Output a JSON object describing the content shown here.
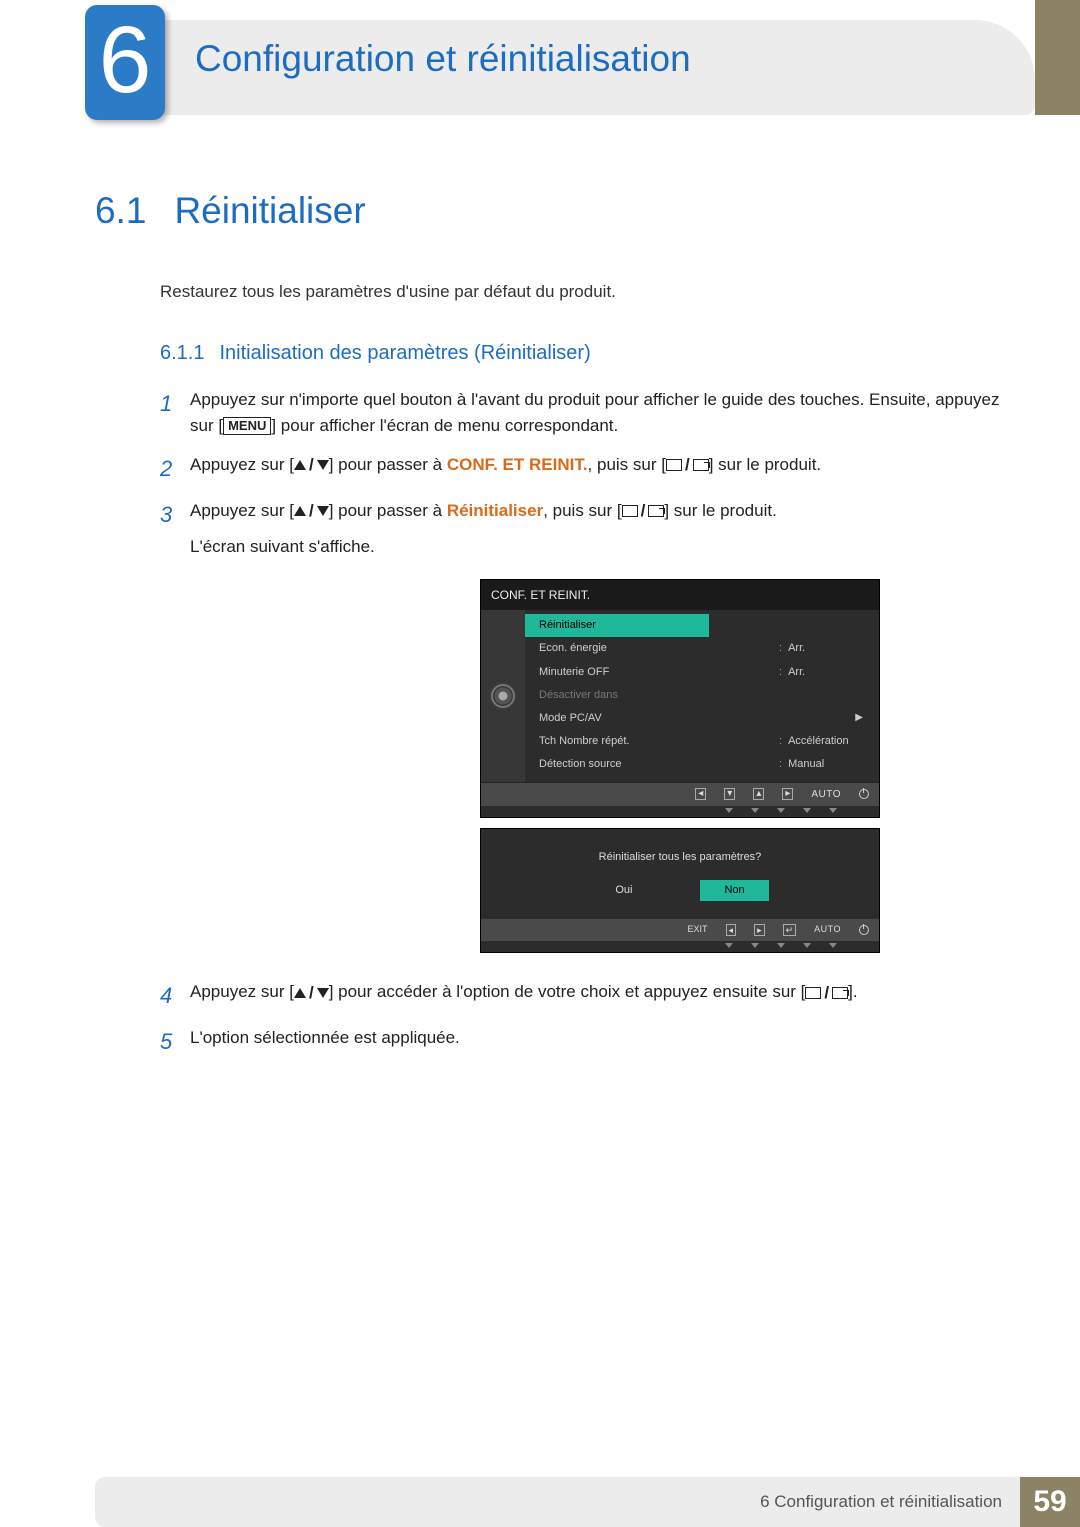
{
  "chapter": {
    "number": "6",
    "title": "Configuration et réinitialisation"
  },
  "section": {
    "number": "6.1",
    "title": "Réinitialiser"
  },
  "intro": "Restaurez tous les paramètres d'usine par défaut du produit.",
  "subsection": {
    "number": "6.1.1",
    "title": "Initialisation des paramètres (Réinitialiser)"
  },
  "steps": {
    "s1a": "Appuyez sur n'importe quel bouton à l'avant du produit pour afficher le guide des touches. Ensuite, appuyez sur [",
    "s1_menu": "MENU",
    "s1b": "] pour afficher l'écran de menu correspondant.",
    "s2a": "Appuyez sur [",
    "s2b": "] pour passer à ",
    "s2_target": "CONF. ET REINIT.",
    "s2c": ", puis sur [",
    "s2d": "] sur le produit.",
    "s3a": "Appuyez sur [",
    "s3b": "] pour passer à ",
    "s3_target": "Réinitialiser",
    "s3c": ", puis sur [",
    "s3d": "] sur le produit.",
    "s3e": "L'écran suivant s'affiche.",
    "s4a": "Appuyez sur [",
    "s4b": "] pour accéder à l'option de votre choix et appuyez ensuite sur [",
    "s4c": "].",
    "s5": "L'option sélectionnée est appliquée."
  },
  "osd1": {
    "title": "CONF. ET REINIT.",
    "items": [
      {
        "label": "Réinitialiser",
        "value": "",
        "selected": true
      },
      {
        "label": "Econ. énergie",
        "value": "Arr."
      },
      {
        "label": "Minuterie OFF",
        "value": "Arr."
      },
      {
        "label": "Désactiver dans",
        "value": ""
      },
      {
        "label": "Mode PC/AV",
        "value": "",
        "arrow": true
      },
      {
        "label": "Tch Nombre répét.",
        "value": "Accélération"
      },
      {
        "label": "Détection source",
        "value": "Manual"
      }
    ],
    "bar_auto": "AUTO"
  },
  "osd2": {
    "question": "Réinitialiser tous les paramètres?",
    "yes": "Oui",
    "no": "Non",
    "exit": "EXIT",
    "auto": "AUTO"
  },
  "footer": {
    "text": "6 Configuration et réinitialisation",
    "page": "59"
  }
}
